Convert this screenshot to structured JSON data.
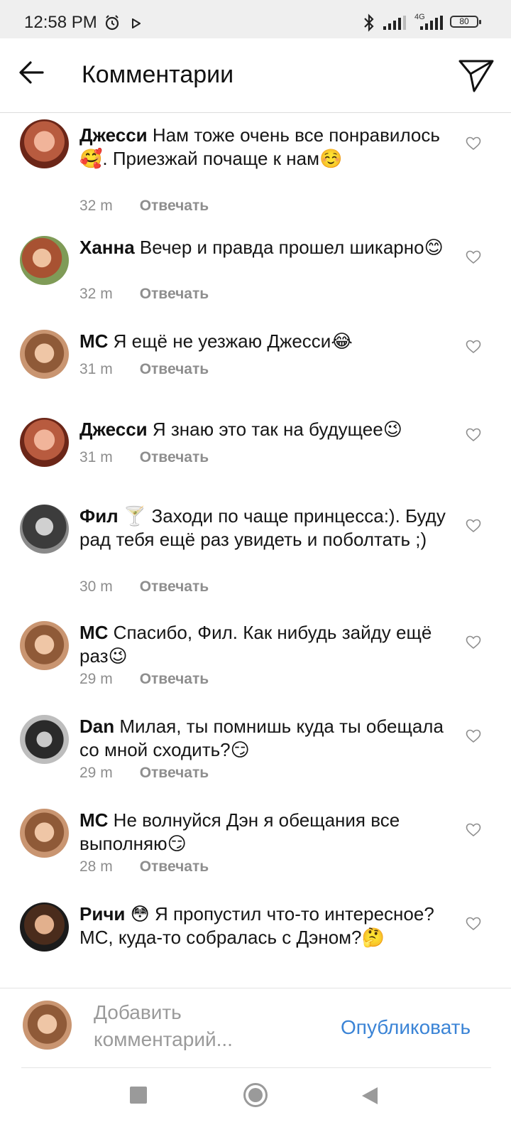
{
  "status_bar": {
    "time": "12:58 PM",
    "network": "4G",
    "battery": "80"
  },
  "header": {
    "title": "Комментарии"
  },
  "comments": [
    {
      "user": "Джесси",
      "text": "Нам тоже очень все понравилось🥰. Приезжай почаще к нам☺️",
      "time": "32 m",
      "reply_label": "Отвечать",
      "avatar": "jessi"
    },
    {
      "user": "Ханна",
      "text": "Вечер и правда прошел шикарно😊",
      "time": "32 m",
      "reply_label": "Отвечать",
      "avatar": "hanna"
    },
    {
      "user": "МС",
      "text": "Я ещё не уезжаю Джесси😂",
      "time": "31 m",
      "reply_label": "Отвечать",
      "avatar": "mc"
    },
    {
      "user": "Джесси",
      "text": "Я знаю это так на будущее😉",
      "time": "31 m",
      "reply_label": "Отвечать",
      "avatar": "jessi"
    },
    {
      "user": "Фил 🍸",
      "text": "Заходи по чаще принцесса:). Буду рад тебя ещё раз увидеть и поболтать ;)",
      "time": "30 m",
      "reply_label": "Отвечать",
      "avatar": "fil"
    },
    {
      "user": "МС",
      "text": "Спасибо, Фил. Как нибудь зайду ещё раз😉",
      "time": "29 m",
      "reply_label": "Отвечать",
      "avatar": "mc"
    },
    {
      "user": "Dan",
      "text": "Милая, ты помнишь куда ты обещала со мной сходить?😏",
      "time": "29 m",
      "reply_label": "Отвечать",
      "avatar": "dan"
    },
    {
      "user": "МС",
      "text": "Не волнуйся Дэн я обещания все выполняю😏",
      "time": "28 m",
      "reply_label": "Отвечать",
      "avatar": "mc"
    },
    {
      "user": "Ричи 😳",
      "text": "Я пропустил что-то интересное? МС, куда-то собралась с Дэном?🤔",
      "time": "",
      "reply_label": "",
      "avatar": "richi"
    }
  ],
  "compose": {
    "placeholder": "Добавить комментарий...",
    "publish_label": "Опубликовать"
  },
  "icons": {
    "back": "arrow-left-icon",
    "send": "paper-plane-icon",
    "like": "heart-outline-icon",
    "alarm": "alarm-clock-icon",
    "play": "play-icon",
    "bluetooth": "bluetooth-icon",
    "signal": "signal-bars-icon"
  },
  "colors": {
    "accent": "#3b84d6",
    "meta_text": "#8e8e8e",
    "status_bar_bg": "#efefef"
  }
}
